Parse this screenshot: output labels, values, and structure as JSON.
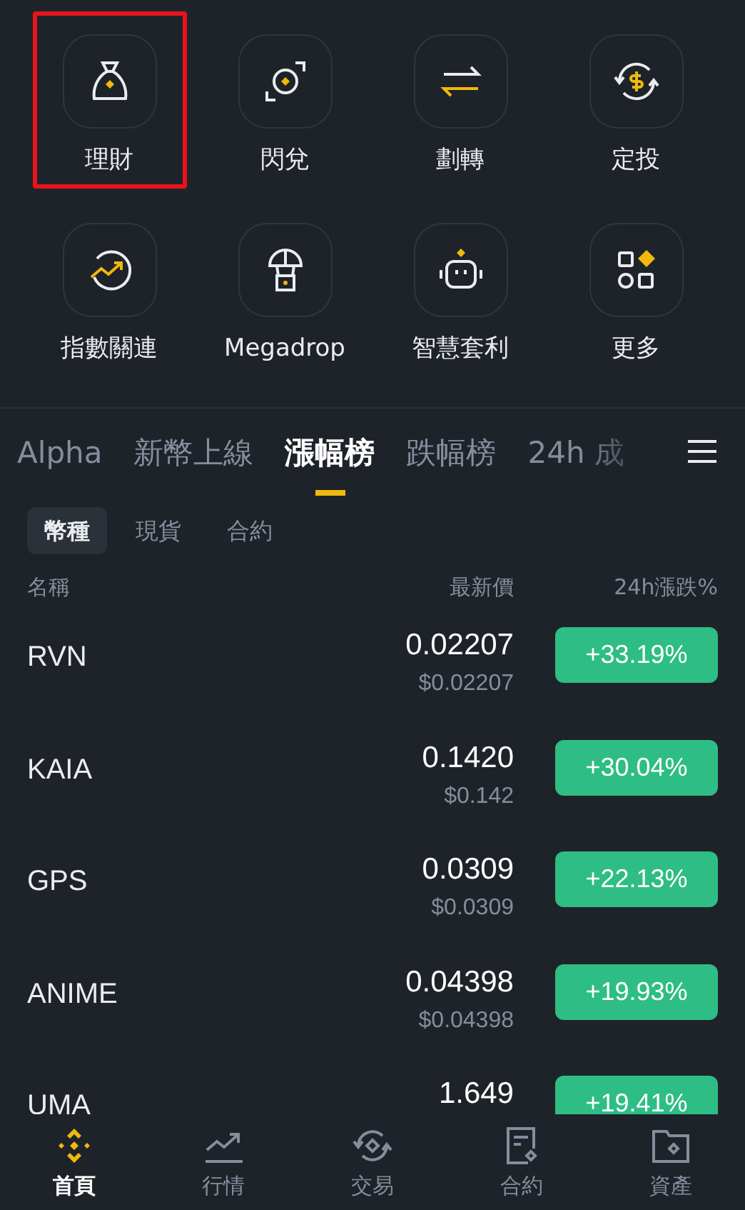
{
  "shortcuts": [
    {
      "label": "理財",
      "highlighted": true
    },
    {
      "label": "閃兌",
      "highlighted": false
    },
    {
      "label": "劃轉",
      "highlighted": false
    },
    {
      "label": "定投",
      "highlighted": false
    },
    {
      "label": "指數關連",
      "highlighted": false
    },
    {
      "label": "Megadrop",
      "highlighted": false
    },
    {
      "label": "智慧套利",
      "highlighted": false
    },
    {
      "label": "更多",
      "highlighted": false
    }
  ],
  "market_tabs": [
    {
      "label": "Alpha",
      "selected": false
    },
    {
      "label": "新幣上線",
      "selected": false
    },
    {
      "label": "漲幅榜",
      "selected": true
    },
    {
      "label": "跌幅榜",
      "selected": false
    },
    {
      "label": "24h 成",
      "selected": false
    }
  ],
  "sub_tabs": [
    {
      "label": "幣種",
      "selected": true
    },
    {
      "label": "現貨",
      "selected": false
    },
    {
      "label": "合約",
      "selected": false
    }
  ],
  "table": {
    "columns": [
      "名稱",
      "最新價",
      "24h漲跌%"
    ],
    "rows": [
      {
        "name": "RVN",
        "price": "0.02207",
        "price_usd": "$0.02207",
        "change": "+33.19%"
      },
      {
        "name": "KAIA",
        "price": "0.1420",
        "price_usd": "$0.142",
        "change": "+30.04%"
      },
      {
        "name": "GPS",
        "price": "0.0309",
        "price_usd": "$0.0309",
        "change": "+22.13%"
      },
      {
        "name": "ANIME",
        "price": "0.04398",
        "price_usd": "$0.04398",
        "change": "+19.93%"
      },
      {
        "name": "UMA",
        "price": "1.649",
        "change": "+19.41%"
      }
    ]
  },
  "bottom_nav": [
    {
      "label": "首頁",
      "selected": true
    },
    {
      "label": "行情",
      "selected": false
    },
    {
      "label": "交易",
      "selected": false
    },
    {
      "label": "合約",
      "selected": false
    },
    {
      "label": "資產",
      "selected": false
    }
  ]
}
